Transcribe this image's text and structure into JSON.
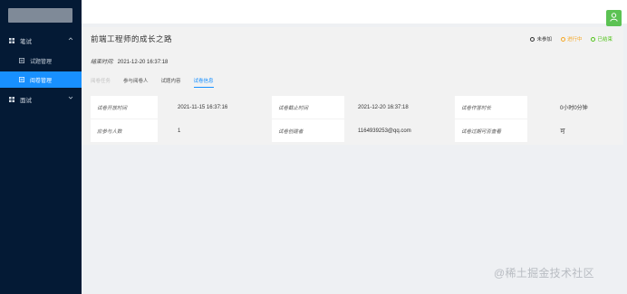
{
  "sidebar": {
    "groups": [
      {
        "label": "笔试",
        "icon": "grid-icon",
        "expanded": true
      },
      {
        "label": "面试",
        "icon": "grid-icon",
        "expanded": false
      }
    ],
    "items": [
      {
        "label": "试题管理",
        "icon": "list-icon",
        "active": false
      },
      {
        "label": "阅卷管理",
        "icon": "list-icon",
        "active": true
      }
    ]
  },
  "header": {
    "avatar_icon": "user-icon",
    "avatar_color": "#5cc253"
  },
  "main": {
    "title": "前端工程师的成长之路",
    "statuses": [
      {
        "label": "未参加",
        "color": "#333333"
      },
      {
        "label": "进行中",
        "color": "#f5a623"
      },
      {
        "label": "已结束",
        "color": "#52c41a"
      }
    ],
    "end_time_label": "结束时间:",
    "end_time_value": "2021-12-20 16:37:18",
    "tabs": [
      {
        "label": "阅卷任务",
        "state": "disabled"
      },
      {
        "label": "参与阅卷人",
        "state": "normal"
      },
      {
        "label": "试题内容",
        "state": "normal"
      },
      {
        "label": "试卷信息",
        "state": "active"
      }
    ],
    "info": {
      "rows": [
        [
          {
            "label": "试卷开放时间",
            "value": "2021-11-15 16:37:16"
          },
          {
            "label": "试卷截止时间",
            "value": "2021-12-20 16:37:18"
          },
          {
            "label": "试卷作答时长",
            "value": "0小时0分钟"
          }
        ],
        [
          {
            "label": "应参与人数",
            "value": "1"
          },
          {
            "label": "试卷创建者",
            "value": "1164939253@qq.com"
          },
          {
            "label": "试卷过期可否查看",
            "value": "可"
          }
        ]
      ]
    }
  },
  "watermark": "@稀土掘金技术社区",
  "colors": {
    "sidebar": "#041a35",
    "accent": "#1890ff"
  }
}
